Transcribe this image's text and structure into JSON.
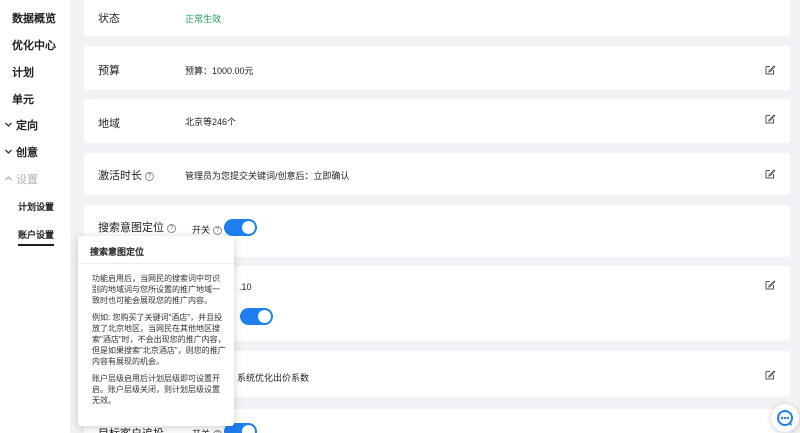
{
  "sidebar": {
    "items": [
      {
        "label": "数据概览"
      },
      {
        "label": "优化中心"
      },
      {
        "label": "计划"
      },
      {
        "label": "单元"
      },
      {
        "label": "定向",
        "chevron": "chevron-down-icon"
      },
      {
        "label": "创意",
        "chevron": "chevron-down-icon"
      },
      {
        "label": "设置",
        "chevron": "chevron-up-icon"
      }
    ],
    "subitems": [
      {
        "label": "计划设置"
      },
      {
        "label": "账户设置",
        "active": true
      }
    ]
  },
  "settings": {
    "status": {
      "label": "状态",
      "value": "正常生效"
    },
    "budget": {
      "label": "预算",
      "value": "预算：1000.00元"
    },
    "region": {
      "label": "地域",
      "value": "北京等246个"
    },
    "activation": {
      "label": "激活时长",
      "value": "管理员为您提交关键词/创意后：立即确认"
    },
    "search_intent": {
      "label": "搜索意图定位",
      "switch_label": "开关",
      "enabled": true
    },
    "partial_value": ".10",
    "bid_text": "系统优化出价系数",
    "target_retarget": {
      "label": "目标客户追投",
      "switch_label": "开关"
    }
  },
  "popover": {
    "title": "搜索意图定位",
    "paragraphs": [
      "功能启用后，当网民的搜索词中可识别的地域词与您所设置的推广地域一致时也可能会展现您的推广内容。",
      "例如: 您购买了关键词\"酒店\"，并且投放了北京地区，当网民在其他地区搜索\"酒店\"时，不会出现您的推广内容，但是如果搜索\"北京酒店\"，则您的推广内容有展现的机会。",
      "账户层级启用后计划层级即可设置开启。账户层级关闭，则计划层级设置无效。"
    ]
  },
  "icons": {
    "edit": "edit-icon",
    "help": "help-icon",
    "customer_service": "customer-service-icon"
  },
  "colors": {
    "accent": "#1e7ff0",
    "status_green": "#1aa05a",
    "background": "#f0f2f5"
  }
}
